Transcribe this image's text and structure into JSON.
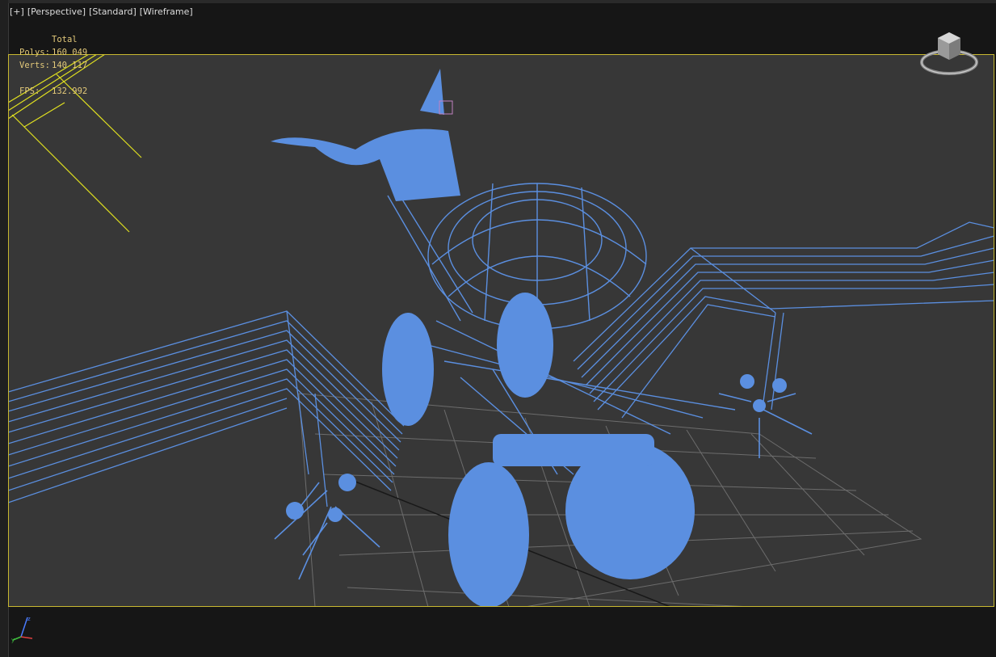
{
  "viewport": {
    "label_plus": "[+]",
    "label_view": "[Perspective]",
    "label_shading": "[Standard]",
    "label_mode": "[Wireframe]"
  },
  "stats": {
    "header": "Total",
    "polys_label": "Polys:",
    "polys_value": "160 049",
    "verts_label": "Verts:",
    "verts_value": "140 117",
    "fps_label": "FPS:",
    "fps_value": "132.992"
  },
  "icons": {
    "viewcube": "viewcube-icon",
    "axis": "axis-tripod-icon"
  },
  "colors": {
    "viewport_bg": "#373737",
    "border": "#c8b830",
    "wire": "#5b8fe0",
    "grid": "#8a8a8a",
    "light": "#e0e020",
    "text": "#e3c97a"
  }
}
